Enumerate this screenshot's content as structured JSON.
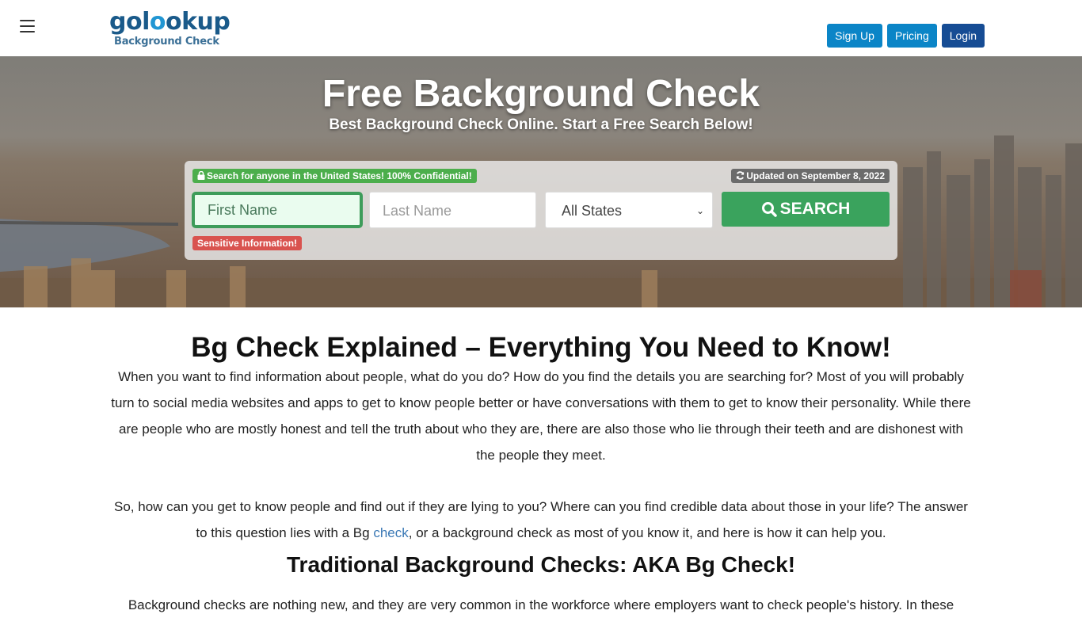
{
  "header": {
    "menu_icon": "hamburger-icon",
    "logo": {
      "text_pre": "gol",
      "text_accent": "o",
      "text_post": "okup",
      "subtitle": "Background Check"
    },
    "buttons": {
      "signup": "Sign Up",
      "pricing": "Pricing",
      "login": "Login"
    },
    "colors": {
      "signup": "#0b85c7",
      "pricing": "#0b85c7",
      "login": "#164c94"
    }
  },
  "hero": {
    "title": "Free Background Check",
    "subtitle": "Best Background Check Online. Start a Free Search Below!",
    "search": {
      "notice": "Search for anyone in the United States! 100% Confidential!",
      "notice_icon": "lock-icon",
      "updated": "Updated on September 8, 2022",
      "updated_icon": "refresh-icon",
      "first_name_placeholder": "First Name",
      "last_name_placeholder": "Last Name",
      "state_selected": "All States",
      "search_label": "SEARCH",
      "search_icon": "search-icon",
      "warning": "Sensitive Information!"
    }
  },
  "content": {
    "heading": "Bg Check Explained – Everything You Need to Know!",
    "para1": "When you want to find information about people, what do you do? How do you find the details you are searching for? Most of you will probably turn to social media websites and apps to get to know people better or have conversations with them to get to know their personality. While there are people who are mostly honest and tell the truth about who they are, there are also those who lie through their teeth and are dishonest with the people they meet.",
    "para2_before": "So, how can you get to know people and find out if they are lying to you? Where can you find credible data about those in your life? The answer to this question lies with a Bg ",
    "para2_link": "check",
    "para2_after": ", or a background check as most of you know it, and here is how it can help you.",
    "subheading": "Traditional Background Checks: AKA Bg Check!",
    "para3": "Background checks are nothing new, and they are very common in the workforce where employers want to check people's history. In these"
  }
}
